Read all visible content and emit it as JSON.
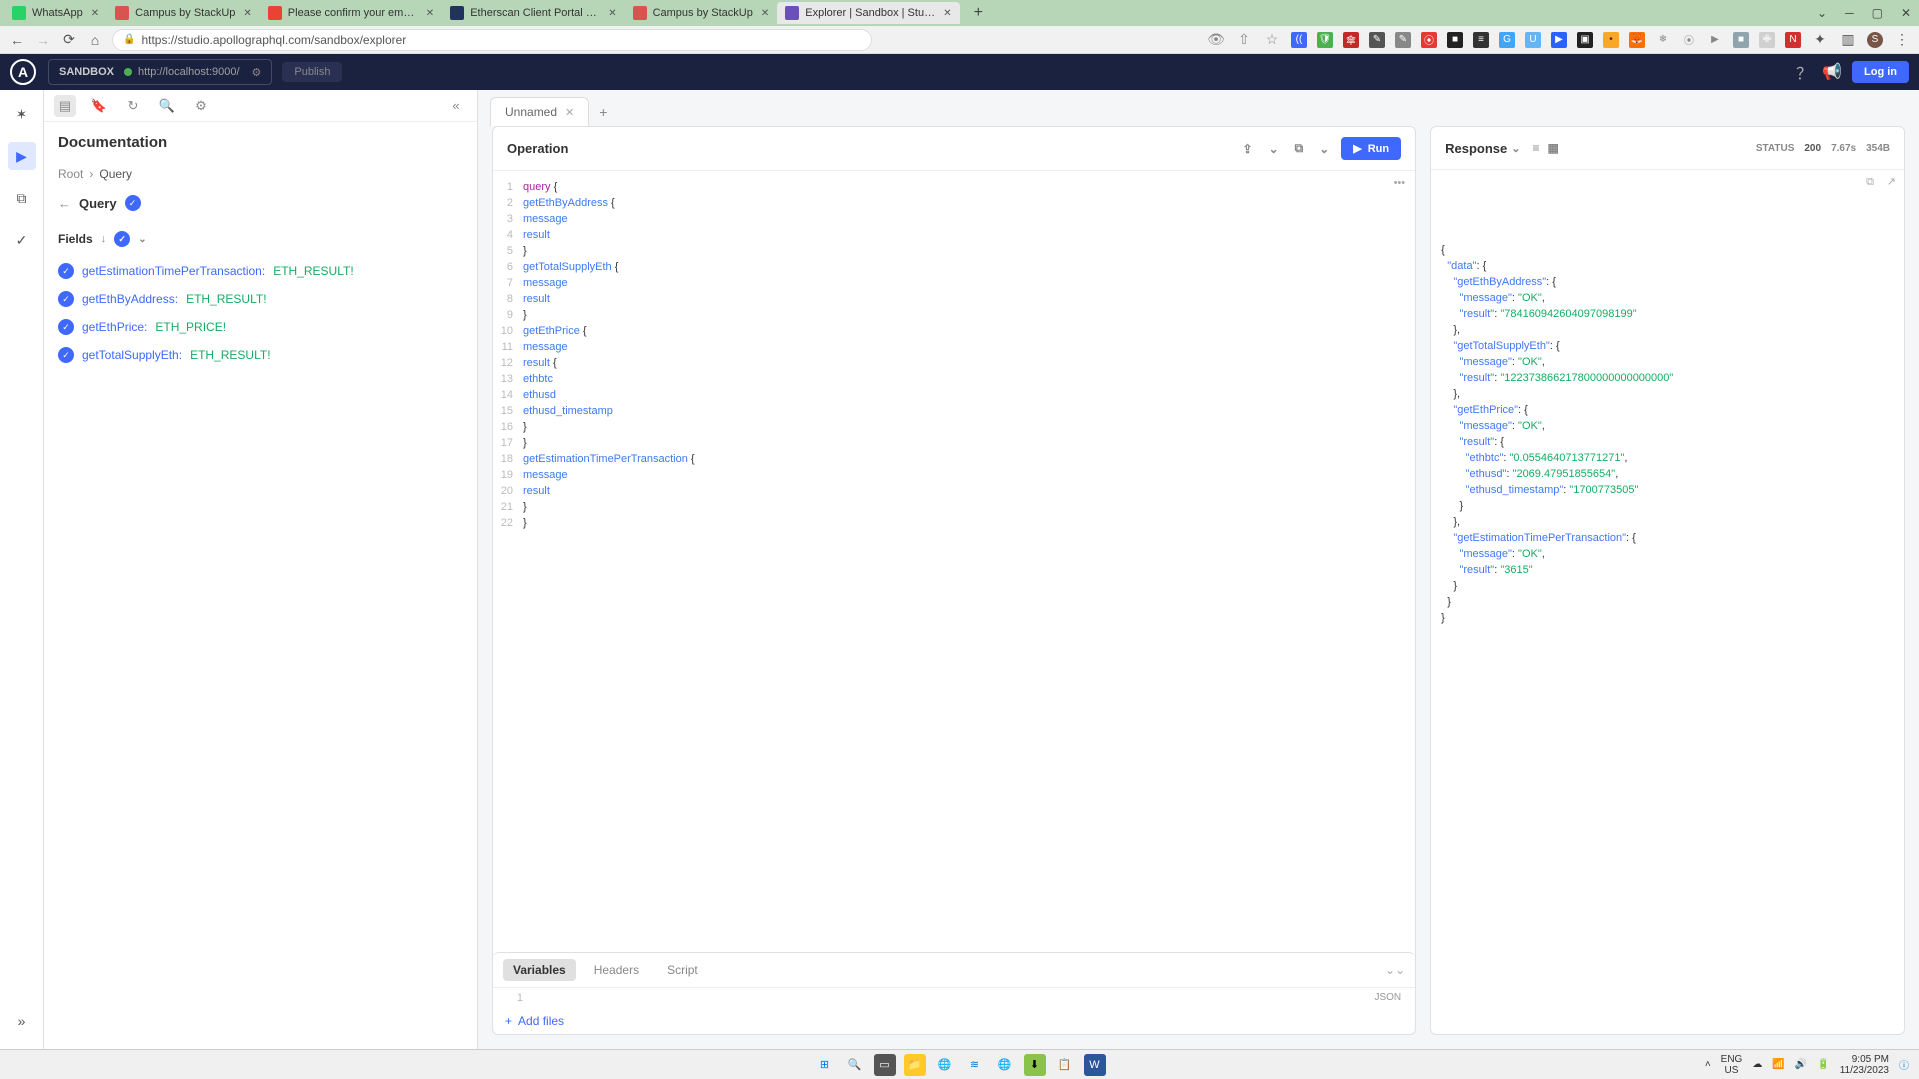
{
  "browser": {
    "tabs": [
      {
        "title": "WhatsApp",
        "iconColor": "#25D366"
      },
      {
        "title": "Campus by StackUp",
        "iconColor": "#d9534f"
      },
      {
        "title": "Please confirm your email [Ether…",
        "iconColor": "#ea4335"
      },
      {
        "title": "Etherscan Client Portal and Servi…",
        "iconColor": "#21325b"
      },
      {
        "title": "Campus by StackUp",
        "iconColor": "#d9534f"
      },
      {
        "title": "Explorer | Sandbox | Studio",
        "iconColor": "#6b4fbb",
        "active": true
      }
    ],
    "url": "https://studio.apollographql.com/sandbox/explorer"
  },
  "apollo": {
    "sandbox_label": "SANDBOX",
    "endpoint": "http://localhost:9000/",
    "publish_label": "Publish",
    "login_label": "Log in"
  },
  "doc": {
    "heading": "Documentation",
    "crumb_root": "Root",
    "crumb_sep": "›",
    "crumb_query": "Query",
    "type_name": "Query",
    "fields_label": "Fields",
    "fields": [
      {
        "name": "getEstimationTimePerTransaction:",
        "type": "ETH_RESULT!"
      },
      {
        "name": "getEthByAddress:",
        "type": "ETH_RESULT!"
      },
      {
        "name": "getEthPrice:",
        "type": "ETH_PRICE!"
      },
      {
        "name": "getTotalSupplyEth:",
        "type": "ETH_RESULT!"
      }
    ]
  },
  "operation": {
    "tab_name": "Unnamed",
    "title": "Operation",
    "run_label": "Run",
    "lines": [
      {
        "n": "1",
        "k": "query",
        "rest": " {"
      },
      {
        "n": "2",
        "indent": "  ",
        "fld": "getEthByAddress",
        "rest": " {"
      },
      {
        "n": "3",
        "indent": "    ",
        "fld": "message"
      },
      {
        "n": "4",
        "indent": "    ",
        "fld": "result"
      },
      {
        "n": "5",
        "indent": "  ",
        "rest": "}"
      },
      {
        "n": "6",
        "indent": "  ",
        "fld": "getTotalSupplyEth",
        "rest": " {"
      },
      {
        "n": "7",
        "indent": "    ",
        "fld": "message"
      },
      {
        "n": "8",
        "indent": "    ",
        "fld": "result"
      },
      {
        "n": "9",
        "indent": "  ",
        "rest": "}"
      },
      {
        "n": "10",
        "indent": "  ",
        "fld": "getEthPrice",
        "rest": " {"
      },
      {
        "n": "11",
        "indent": "    ",
        "fld": "message"
      },
      {
        "n": "12",
        "indent": "    ",
        "fld": "result",
        "rest": " {"
      },
      {
        "n": "13",
        "indent": "      ",
        "fld": "ethbtc"
      },
      {
        "n": "14",
        "indent": "      ",
        "fld": "ethusd"
      },
      {
        "n": "15",
        "indent": "      ",
        "fld": "ethusd_timestamp"
      },
      {
        "n": "16",
        "indent": "    ",
        "rest": "}"
      },
      {
        "n": "17",
        "indent": "  ",
        "rest": "}"
      },
      {
        "n": "18",
        "indent": "  ",
        "fld": "getEstimationTimePerTransaction",
        "rest": " {"
      },
      {
        "n": "19",
        "indent": "    ",
        "fld": "message"
      },
      {
        "n": "20",
        "indent": "    ",
        "fld": "result"
      },
      {
        "n": "21",
        "indent": "  ",
        "rest": "}"
      },
      {
        "n": "22",
        "rest": "}"
      }
    ]
  },
  "response": {
    "title": "Response",
    "status_label": "STATUS",
    "status": "200",
    "time": "7.67s",
    "size": "354B",
    "json": "{\n  \"data\": {\n    \"getEthByAddress\": {\n      \"message\": \"OK\",\n      \"result\": \"784160942604097098199\"\n    },\n    \"getTotalSupplyEth\": {\n      \"message\": \"OK\",\n      \"result\": \"122373866217800000000000000\"\n    },\n    \"getEthPrice\": {\n      \"message\": \"OK\",\n      \"result\": {\n        \"ethbtc\": \"0.0554640713771271\",\n        \"ethusd\": \"2069.47951855654\",\n        \"ethusd_timestamp\": \"1700773505\"\n      }\n    },\n    \"getEstimationTimePerTransaction\": {\n      \"message\": \"OK\",\n      \"result\": \"3615\"\n    }\n  }\n}"
  },
  "vars": {
    "tab_variables": "Variables",
    "tab_headers": "Headers",
    "tab_script": "Script",
    "line1": "1",
    "json_badge": "JSON",
    "add_files": "Add files"
  },
  "taskbar": {
    "lang1": "ENG",
    "lang2": "US",
    "time": "9:05 PM",
    "date": "11/23/2023"
  }
}
